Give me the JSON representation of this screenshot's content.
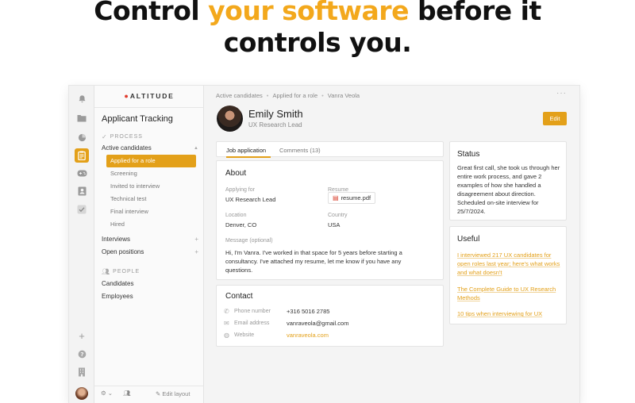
{
  "headline": {
    "line1_pre": "Control ",
    "line1_accent": "your software",
    "line1_post": " before it",
    "line2": "controls you."
  },
  "colors": {
    "accent": "#e3a019",
    "headline_accent": "#f3a81c",
    "link": "#e3a019"
  },
  "rail": {
    "icons": [
      "bell-icon",
      "folder-icon",
      "pie-chart-icon",
      "clipboard-icon",
      "gamepad-icon",
      "contact-card-icon",
      "check-icon",
      "plus-icon",
      "help-icon",
      "building-icon"
    ],
    "active": "clipboard-icon"
  },
  "sidebar": {
    "brand": "ALTITUDE",
    "title": "Applicant Tracking",
    "process_header": "PROCESS",
    "active_candidates": "Active candidates",
    "subitems": [
      "Applied for a role",
      "Screening",
      "Invited to interview",
      "Technical test",
      "Final interview",
      "Hired"
    ],
    "interviews": "Interviews",
    "open_positions": "Open positions",
    "people_header": "PEOPLE",
    "candidates": "Candidates",
    "employees": "Employees",
    "edit_layout": "Edit layout"
  },
  "breadcrumb": [
    "Active candidates",
    "Applied for a role",
    "Vanra Veola"
  ],
  "profile": {
    "name": "Emily Smith",
    "role": "UX Research Lead",
    "edit_label": "Edit"
  },
  "tabs": [
    "Job application",
    "Comments (13)"
  ],
  "about": {
    "title": "About",
    "applying_for_label": "Applying for",
    "applying_for": "UX Research Lead",
    "resume_label": "Resume",
    "resume_file": "resume.pdf",
    "location_label": "Location",
    "location": "Denver, CO",
    "country_label": "Country",
    "country": "USA",
    "message_label": "Message (optional)",
    "message": "Hi, I'm Vanra. I've worked in that space for 5 years before starting a consultancy. I've attached my resume, let me know if you have any questions."
  },
  "contact": {
    "title": "Contact",
    "phone_label": "Phone number",
    "phone": "+316 5016 2785",
    "email_label": "Email address",
    "email": "vanraveola@gmail.com",
    "website_label": "Website",
    "website": "vanraveola.com"
  },
  "status": {
    "title": "Status",
    "text": "Great first call, she took us through her entire work process, and gave 2 examples of how she handled a disagreement about direction. Scheduled on-site interview for 25/7/2024."
  },
  "useful": {
    "title": "Useful",
    "links": [
      "I interviewed 217 UX candidates for open roles last year; here's what works and what doesn't",
      "The Complete Guide to UX Research Methods",
      "10 tips when interviewing for UX"
    ]
  }
}
